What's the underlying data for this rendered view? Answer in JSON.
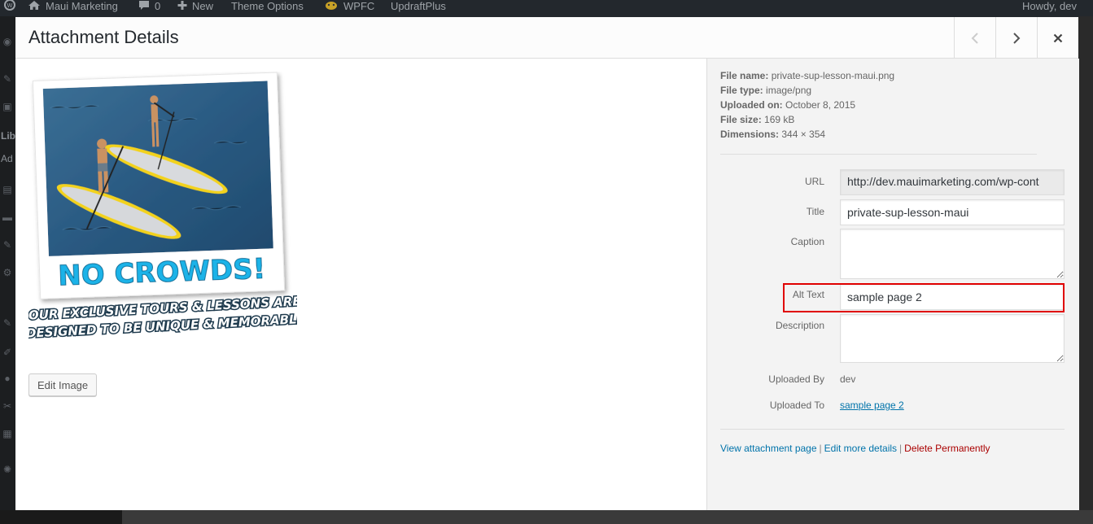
{
  "admin_bar": {
    "site_name": "Maui Marketing",
    "comments_count": "0",
    "new_label": "New",
    "theme_options_label": "Theme Options",
    "wpfc_label": "WPFC",
    "updraft_label": "UpdraftPlus",
    "howdy_label": "Howdy, dev"
  },
  "sidebar_fragments": {
    "lib": "Lib",
    "ad": "Ad"
  },
  "modal": {
    "title": "Attachment Details",
    "prev_icon": "chevron-left-icon",
    "next_icon": "chevron-right-icon",
    "close_icon": "close-icon"
  },
  "preview": {
    "headline": "NO CROWDS!",
    "tagline_line1": "OUR EXCLUSIVE TOURS & LESSONS ARE",
    "tagline_line2": "DESIGNED TO BE UNIQUE & MEMORABLE",
    "edit_button_label": "Edit Image"
  },
  "file_info": {
    "file_name_label": "File name:",
    "file_name": "private-sup-lesson-maui.png",
    "file_type_label": "File type:",
    "file_type": "image/png",
    "uploaded_on_label": "Uploaded on:",
    "uploaded_on": "October 8, 2015",
    "file_size_label": "File size:",
    "file_size": "169 kB",
    "dimensions_label": "Dimensions:",
    "dimensions": "344 × 354"
  },
  "fields": {
    "url_label": "URL",
    "url_value": "http://dev.mauimarketing.com/wp-cont",
    "title_label": "Title",
    "title_value": "private-sup-lesson-maui",
    "caption_label": "Caption",
    "caption_value": "",
    "alt_label": "Alt Text",
    "alt_value": "sample page 2",
    "description_label": "Description",
    "description_value": "",
    "uploaded_by_label": "Uploaded By",
    "uploaded_by": "dev",
    "uploaded_to_label": "Uploaded To",
    "uploaded_to": "sample page 2"
  },
  "actions": {
    "view": "View attachment page",
    "edit": "Edit more details",
    "delete": "Delete Permanently",
    "separator": "|"
  },
  "colors": {
    "highlight": "#e00000",
    "link": "#0073aa",
    "delete": "#aa0000",
    "headline": "#1db3e8"
  }
}
